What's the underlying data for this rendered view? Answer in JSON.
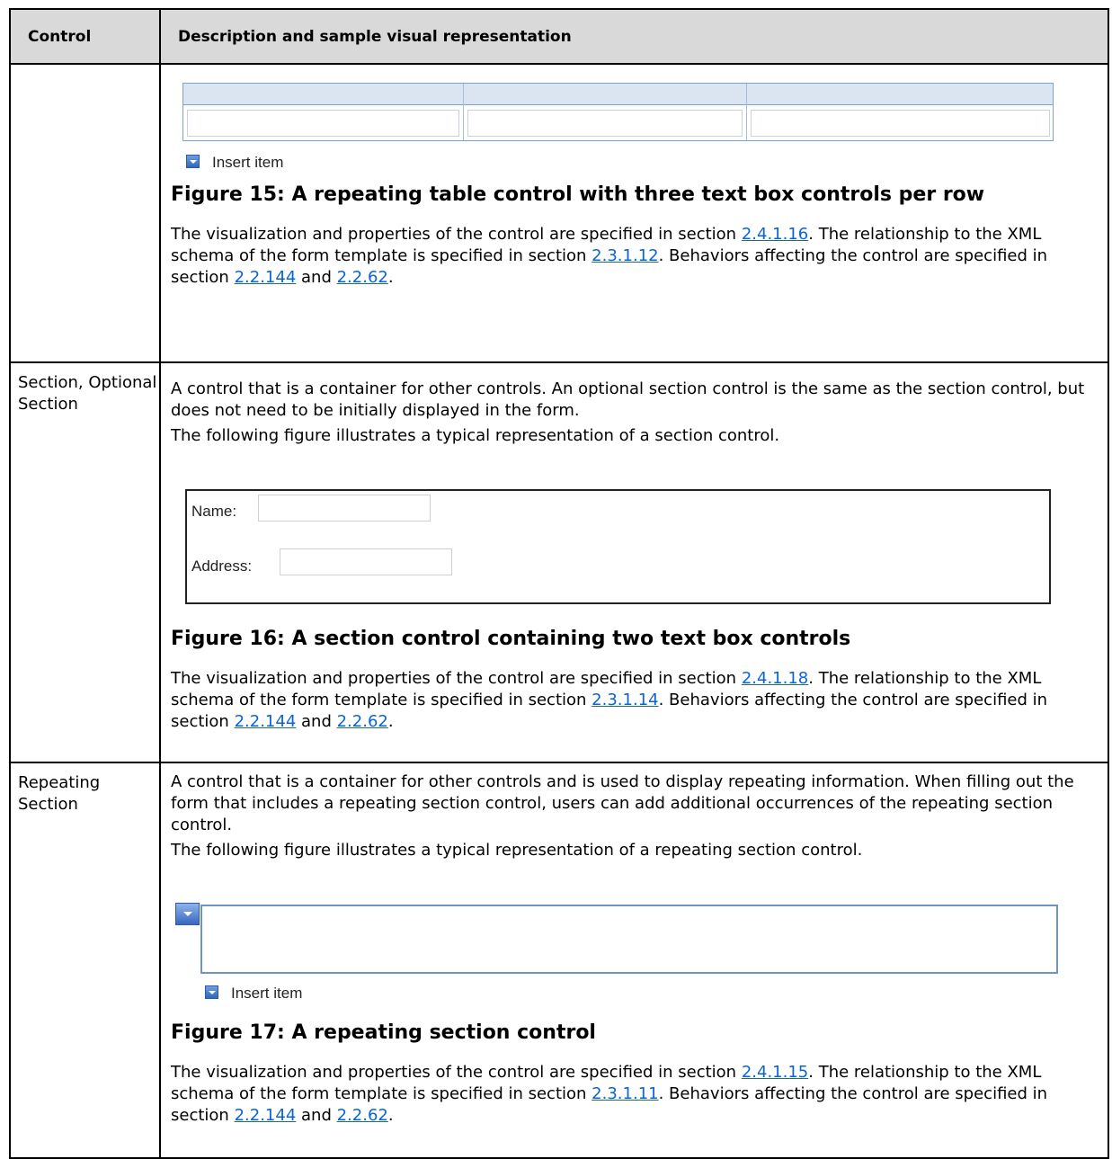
{
  "table": {
    "headers": [
      "Control",
      "Description and sample visual representation"
    ]
  },
  "rows": [
    {
      "control": "",
      "insert_item": "Insert item",
      "figure": "Figure 15: A repeating table control with three text box controls per row",
      "spec": {
        "t1": "The visualization and properties of the control are specified in section ",
        "l1": "2.4.1.16",
        "t2": ". The relationship to the XML schema of the form template is specified in section ",
        "l2": "2.3.1.12",
        "t3": ". Behaviors affecting the control are specified in section ",
        "l3": "2.2.144",
        "t4": " and ",
        "l4": "2.2.62",
        "t5": "."
      }
    },
    {
      "control": "Section, Optional Section",
      "desc1": "A control that is a container for other controls. An optional section control is the same as the section control, but does not need to be initially displayed in the form.",
      "desc2": "The following figure illustrates a typical representation of a section control.",
      "name_label": "Name:",
      "address_label": "Address:",
      "figure": "Figure 16: A section control containing two text box controls",
      "spec": {
        "t1": "The visualization and properties of the control are specified in section ",
        "l1": "2.4.1.18",
        "t2": ". The relationship to the XML schema of the form template is specified in section ",
        "l2": "2.3.1.14",
        "t3": ". Behaviors affecting the control are specified in section ",
        "l3": "2.2.144",
        "t4": " and ",
        "l4": "2.2.62",
        "t5": "."
      }
    },
    {
      "control": "Repeating Section",
      "desc1": "A control that is a container for other controls and is used to display repeating information. When filling out the form that includes a repeating section control, users can add additional occurrences of the repeating section control.",
      "desc2": "The following figure illustrates a typical representation of a repeating section control.",
      "insert_item": "Insert item",
      "figure": "Figure 17: A repeating section control",
      "spec": {
        "t1": "The visualization and properties of the control are specified in section ",
        "l1": "2.4.1.15",
        "t2": ". The relationship to the XML schema of the form template is specified in section ",
        "l2": "2.3.1.11",
        "t3": ". Behaviors affecting the control are specified in section ",
        "l3": "2.2.144",
        "t4": " and ",
        "l4": "2.2.62",
        "t5": "."
      }
    }
  ]
}
